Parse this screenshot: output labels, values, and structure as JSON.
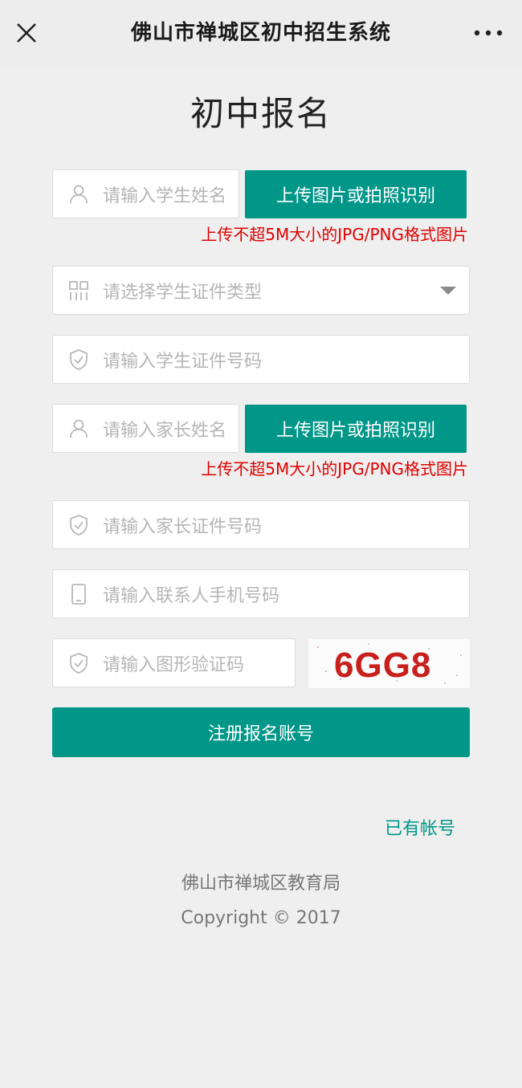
{
  "header": {
    "title": "佛山市禅城区初中招生系统",
    "close_icon": "close-icon",
    "more_icon": "more-dots-icon"
  },
  "page_title": "初中报名",
  "form": {
    "student_name_placeholder": "请输入学生姓名",
    "upload_button_label": "上传图片或拍照识别",
    "upload_note": "上传不超5M大小的JPG/PNG格式图片",
    "id_type_placeholder": "请选择学生证件类型",
    "student_id_placeholder": "请输入学生证件号码",
    "parent_name_placeholder": "请输入家长姓名",
    "parent_id_placeholder": "请输入家长证件号码",
    "phone_placeholder": "请输入联系人手机号码",
    "captcha_placeholder": "请输入图形验证码",
    "captcha_text": "6GG8",
    "submit_label": "注册报名账号"
  },
  "login_link": "已有帐号",
  "footer": {
    "org": "佛山市禅城区教育局",
    "copyright": "Copyright © 2017"
  },
  "colors": {
    "accent": "#009688",
    "warning": "#e00000"
  }
}
